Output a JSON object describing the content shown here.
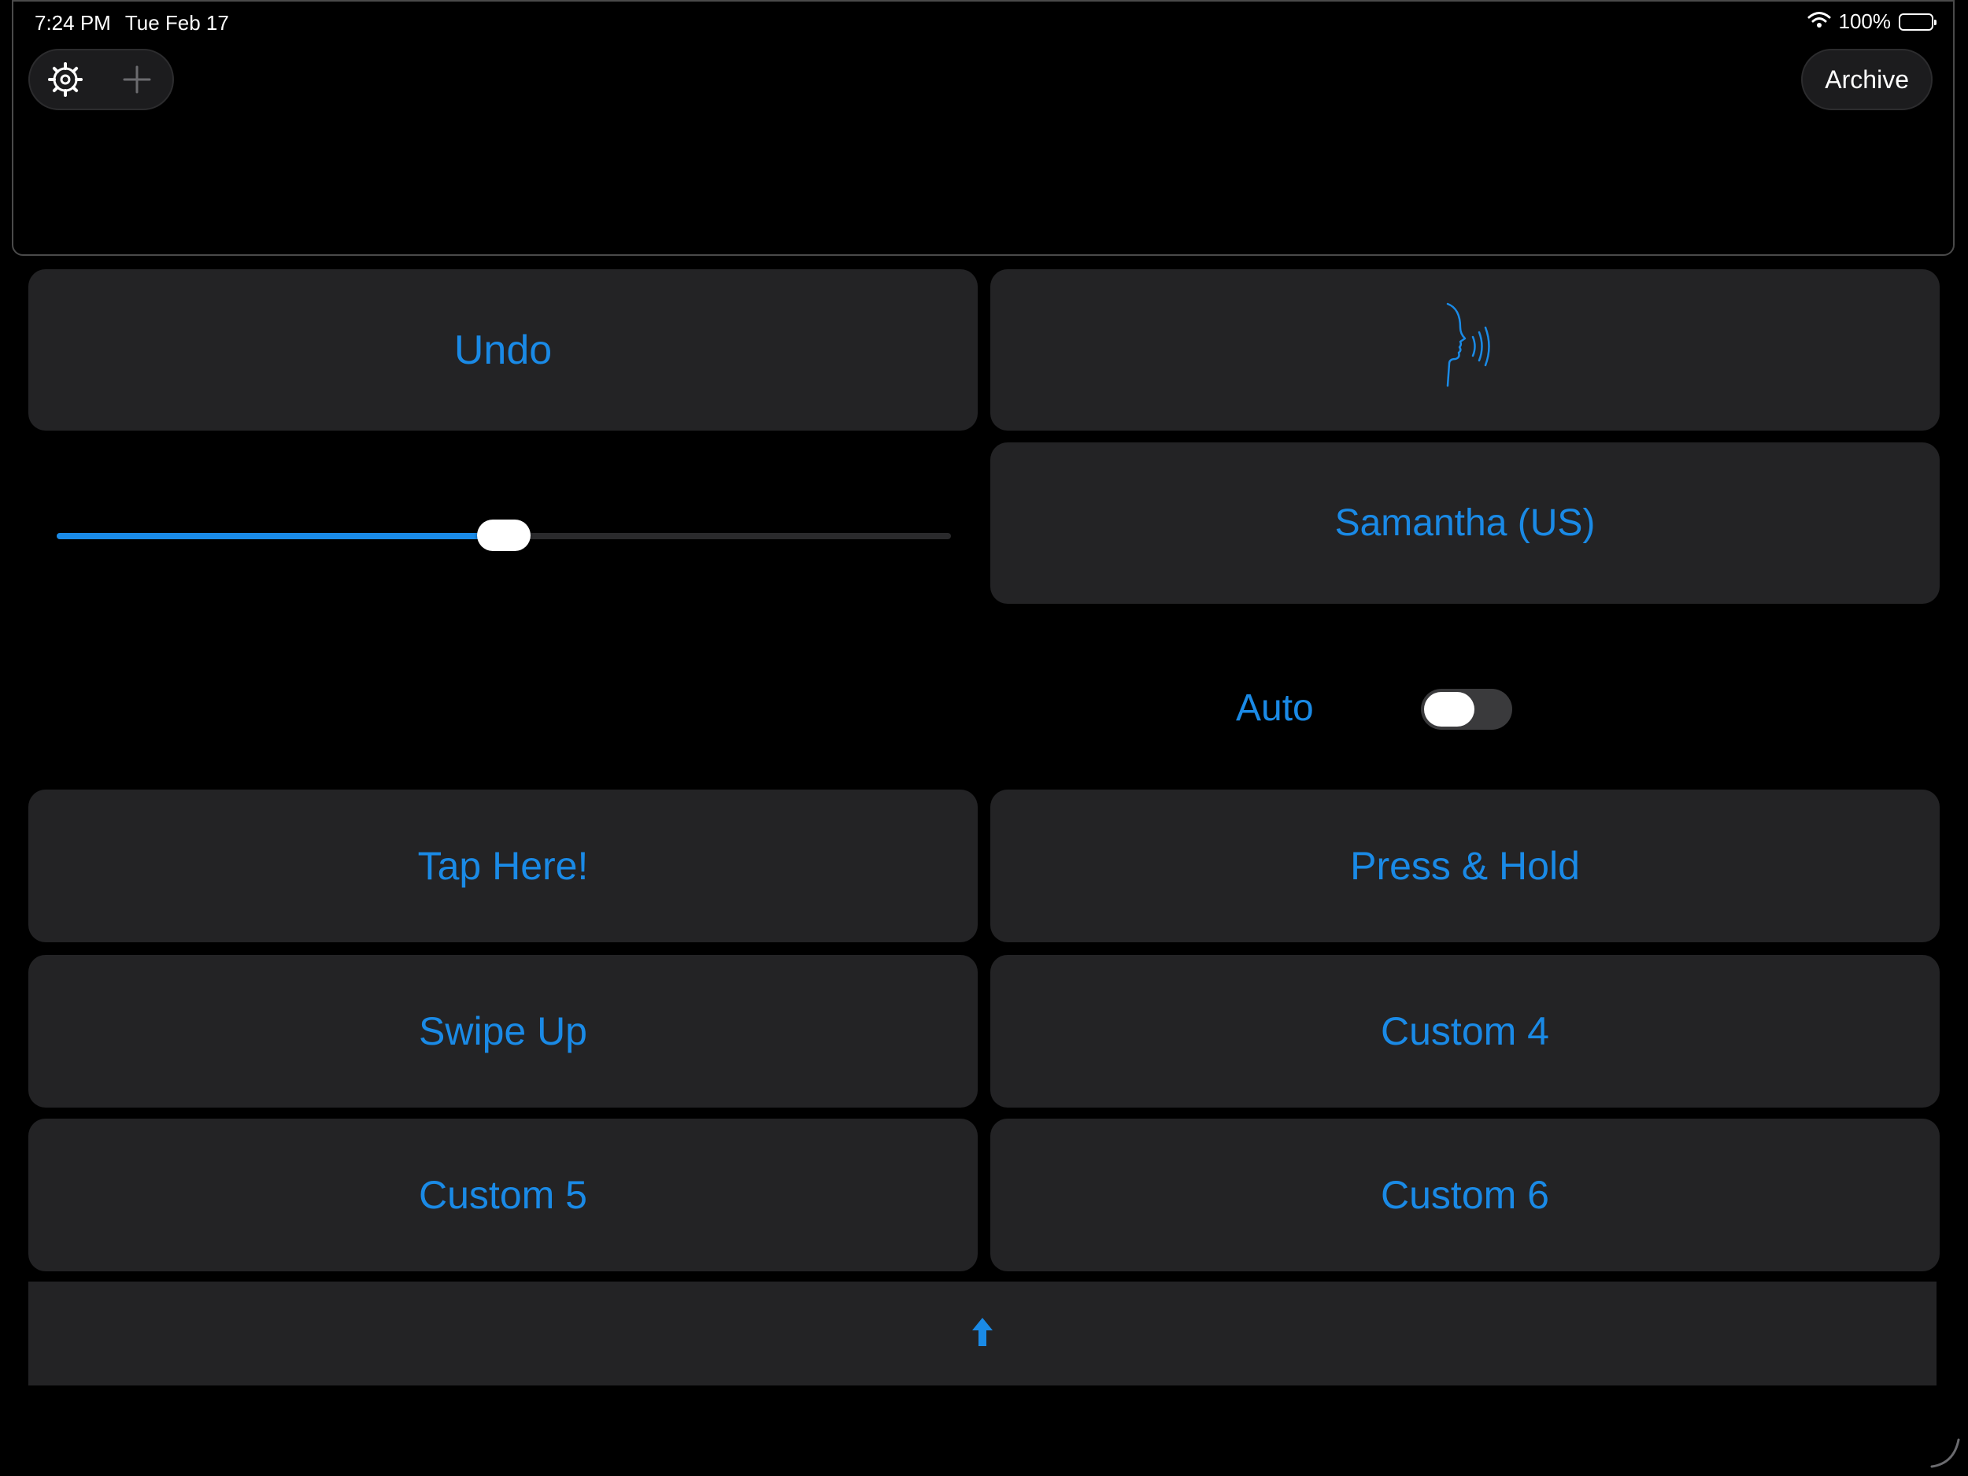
{
  "status_bar": {
    "time": "7:24 PM",
    "date": "Tue Feb 17",
    "battery": "100%",
    "icons": [
      "wifi-icon",
      "battery-icon"
    ]
  },
  "toolbar": {
    "left_icons": [
      "settings-gear-icon",
      "plus-icon"
    ],
    "archive_label": "Archive"
  },
  "text_display": {
    "value": ""
  },
  "buttons": {
    "undo": "Undo",
    "speak_icon": "speaking-head-icon",
    "voice": "Samantha (US)",
    "tap_here": "Tap Here!",
    "press_hold": "Press & Hold",
    "swipe_up": "Swipe Up",
    "custom4": "Custom 4",
    "custom5": "Custom 5",
    "custom6": "Custom 6",
    "bottom_icon": "up-arrow-icon"
  },
  "slider": {
    "value": 0.5
  },
  "auto_toggle": {
    "label": "Auto",
    "on": false
  },
  "colors": {
    "accent": "#1a8ae6",
    "tile": "#232325",
    "background": "#000000",
    "slider_track": "#2a2a2c",
    "toggle_off": "#3a3a3c"
  }
}
